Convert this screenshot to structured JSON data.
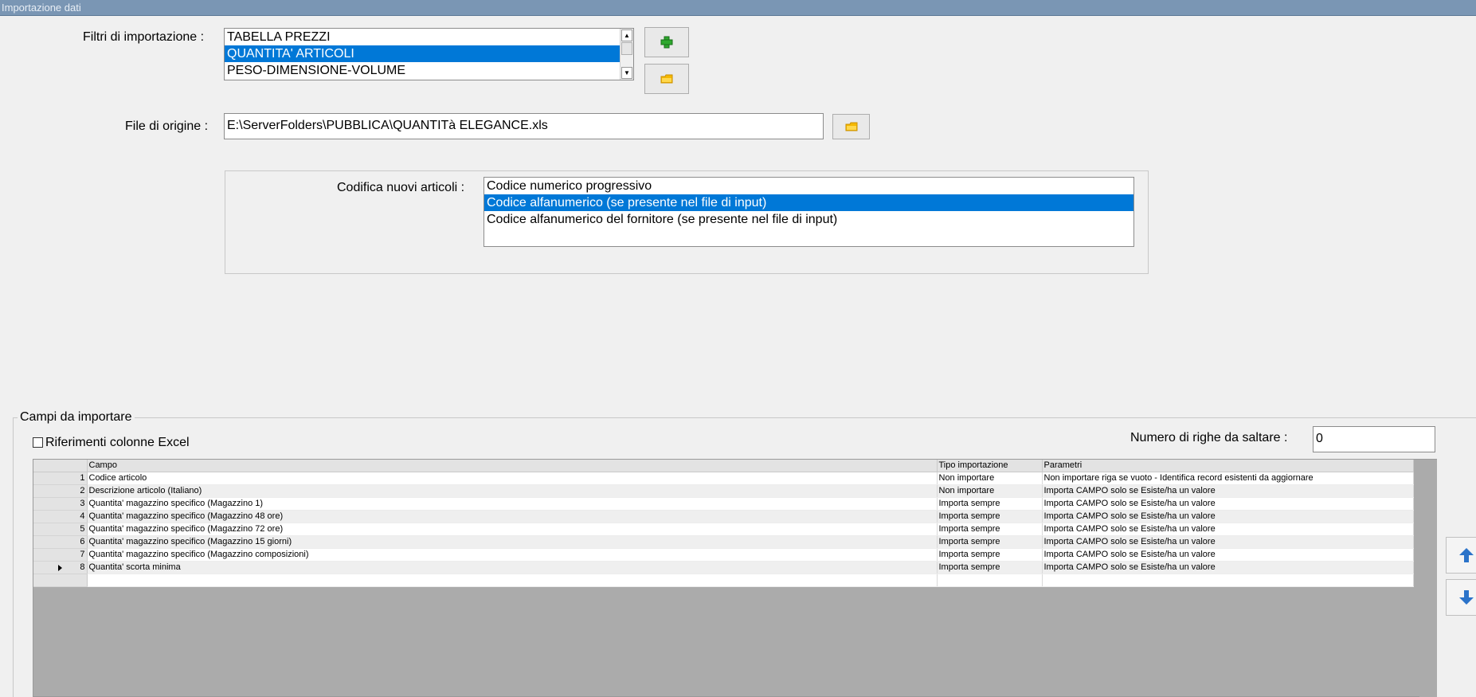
{
  "window": {
    "title": "Importazione dati"
  },
  "filters": {
    "label": "Filtri di importazione :",
    "items": [
      "TABELLA PREZZI",
      "QUANTITA' ARTICOLI",
      "PESO-DIMENSIONE-VOLUME"
    ],
    "selected_index": 1,
    "add_icon": "plus-icon",
    "open_icon": "folder-icon"
  },
  "source_file": {
    "label": "File di origine :",
    "value": "E:\\ServerFolders\\PUBBLICA\\QUANTITà ELEGANCE.xls",
    "browse_icon": "folder-icon"
  },
  "coding": {
    "label": "Codifica nuovi articoli :",
    "options": [
      "Codice numerico progressivo",
      "Codice alfanumerico (se presente nel file di input)",
      "Codice alfanumerico del fornitore (se presente nel file di input)"
    ],
    "selected_index": 1
  },
  "fields_group": {
    "title": "Campi da importare",
    "excel_refs_label": "Riferimenti colonne Excel",
    "excel_refs_checked": false,
    "skip_rows_label": "Numero di righe da saltare  :",
    "skip_rows_value": "0"
  },
  "grid": {
    "columns": [
      "Campo",
      "Tipo importazione",
      "Parametri"
    ],
    "current_row": 8,
    "rows": [
      {
        "n": "1",
        "campo": "Codice articolo",
        "tipo": "Non importare",
        "parametri": "Non importare riga se vuoto - Identifica record esistenti da aggiornare"
      },
      {
        "n": "2",
        "campo": "Descrizione articolo (Italiano)",
        "tipo": "Non importare",
        "parametri": "Importa CAMPO solo se Esiste/ha un valore"
      },
      {
        "n": "3",
        "campo": "Quantita' magazzino specifico (Magazzino 1)",
        "tipo": "Importa sempre",
        "parametri": "Importa CAMPO solo se Esiste/ha un valore"
      },
      {
        "n": "4",
        "campo": "Quantita' magazzino specifico (Magazzino 48 ore)",
        "tipo": "Importa sempre",
        "parametri": "Importa CAMPO solo se Esiste/ha un valore"
      },
      {
        "n": "5",
        "campo": "Quantita' magazzino specifico (Magazzino 72 ore)",
        "tipo": "Importa sempre",
        "parametri": "Importa CAMPO solo se Esiste/ha un valore"
      },
      {
        "n": "6",
        "campo": "Quantita' magazzino specifico (Magazzino 15 giorni)",
        "tipo": "Importa sempre",
        "parametri": "Importa CAMPO solo se Esiste/ha un valore"
      },
      {
        "n": "7",
        "campo": "Quantita' magazzino specifico (Magazzino composizioni)",
        "tipo": "Importa sempre",
        "parametri": "Importa CAMPO solo se Esiste/ha un valore"
      },
      {
        "n": "8",
        "campo": "Quantita' scorta minima",
        "tipo": "Importa sempre",
        "parametri": "Importa CAMPO solo se Esiste/ha un valore"
      }
    ]
  },
  "side_buttons": {
    "up_icon": "arrow-up-icon",
    "down_icon": "arrow-down-icon"
  },
  "colors": {
    "selection": "#0078d7",
    "titlebar": "#7a96b4",
    "grid_empty": "#ababab"
  }
}
